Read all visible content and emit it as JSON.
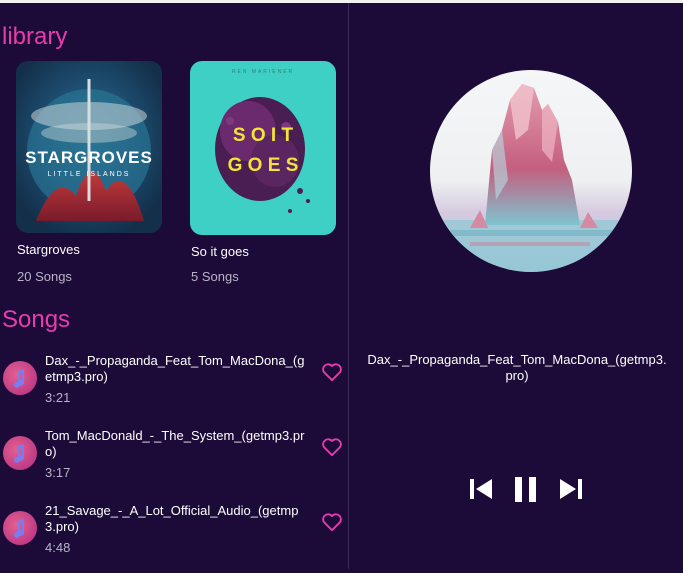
{
  "library": {
    "title": "library",
    "albums": [
      {
        "name": "Stargroves",
        "count": "20 Songs",
        "cover_title": "STARGROVES",
        "cover_subtitle": "LITTLE ISLANDS"
      },
      {
        "name": "So it goes",
        "count": "5 Songs",
        "cover_letters_top": "S O I T",
        "cover_letters_bottom": "G O E S",
        "cover_artist": "REN MARIENER"
      }
    ]
  },
  "songs": {
    "title": "Songs",
    "items": [
      {
        "title": "Dax_-_Propaganda_Feat_Tom_MacDona_(getmp3.pro)",
        "duration": "3:21"
      },
      {
        "title": "Tom_MacDonald_-_The_System_(getmp3.pro)",
        "duration": "3:17"
      },
      {
        "title": "21_Savage_-_A_Lot_Official_Audio_(getmp3.pro)",
        "duration": "4:48"
      }
    ]
  },
  "player": {
    "now_playing_title": "Dax_-_Propaganda_Feat_Tom_MacDona_(getmp3.pro)",
    "controls": [
      "skip-previous-icon",
      "pause-icon",
      "skip-next-icon"
    ]
  },
  "colors": {
    "background": "#1c0b38",
    "accent": "#e83cae",
    "text": "#ffffff",
    "muted": "#b9b3c8"
  }
}
